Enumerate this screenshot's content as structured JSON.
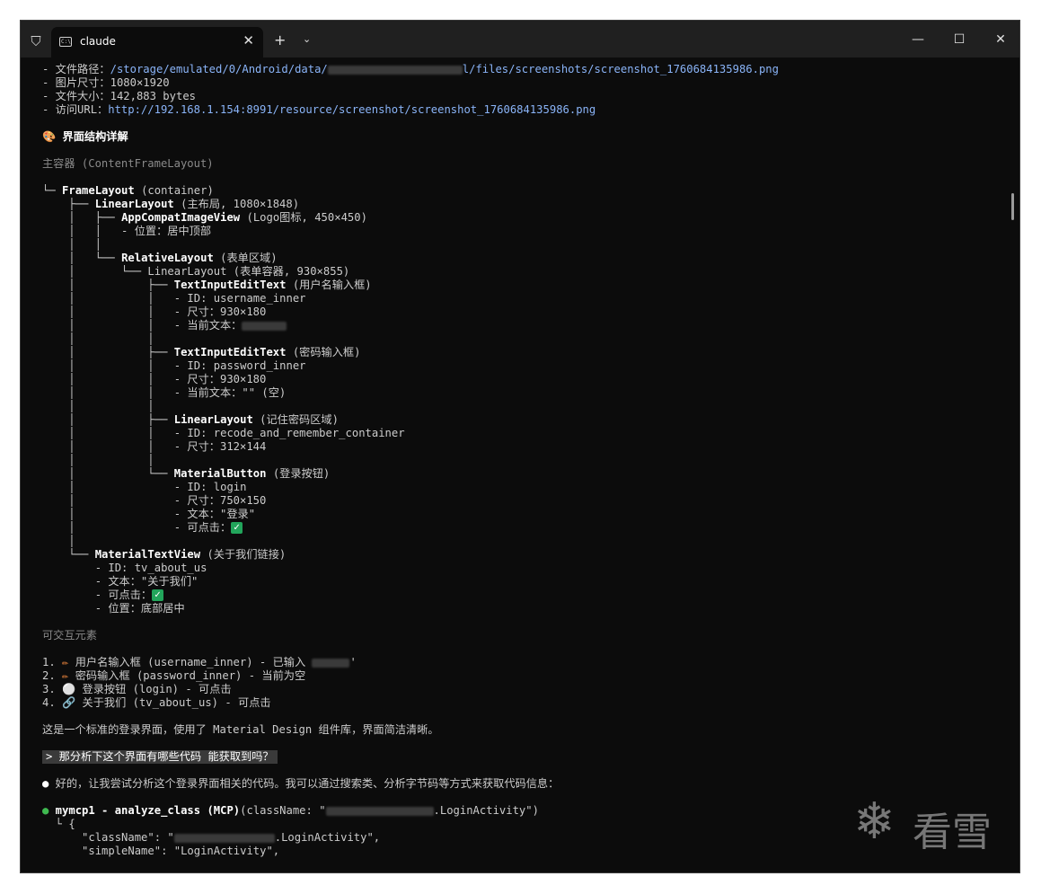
{
  "window": {
    "tab_title": "claude",
    "tab_close": "✕",
    "new_tab": "+",
    "dropdown": "⌄",
    "minimize": "—",
    "maximize": "☐",
    "close": "✕"
  },
  "lines": {
    "l1a": "- 文件路径：",
    "l1b": "/storage/emulated/0/Android/data/",
    "l1c": "l/files/screenshots/screenshot_1760684135986.png",
    "l2": "- 图片尺寸：1080×1920",
    "l3": "- 文件大小：142,883 bytes",
    "l4a": "- 访问URL：",
    "l4b": "http://192.168.1.154:8991/resource/screenshot/screenshot_1760684135986.png",
    "l5": "🎨 界面结构详解",
    "l6": "主容器 (ContentFrameLayout)",
    "t1a": "└─ ",
    "t1b": "FrameLayout",
    "t1c": " (container)",
    "t2a": "    ├── ",
    "t2b": "LinearLayout",
    "t2c": " (主布局, 1080×1848)",
    "t3a": "    │   ├── ",
    "t3b": "AppCompatImageView",
    "t3c": " (Logo图标, 450×450)",
    "t4": "    │   │   - 位置：居中顶部",
    "t5": "    │   │",
    "t6a": "    │   └── ",
    "t6b": "RelativeLayout",
    "t6c": " (表单区域)",
    "t7": "    │       └── LinearLayout (表单容器, 930×855)",
    "t8a": "    │           ├── ",
    "t8b": "TextInputEditText",
    "t8c": " (用户名输入框)",
    "t9": "    │           │   - ID: username_inner",
    "t10": "    │           │   - 尺寸：930×180",
    "t11": "    │           │   - 当前文本：",
    "t12": "    │           │",
    "t13a": "    │           ├── ",
    "t13b": "TextInputEditText",
    "t13c": " (密码输入框)",
    "t14": "    │           │   - ID: password_inner",
    "t15": "    │           │   - 尺寸：930×180",
    "t16": "    │           │   - 当前文本：\"\" (空)",
    "t17": "    │           │",
    "t18a": "    │           ├── ",
    "t18b": "LinearLayout",
    "t18c": " (记住密码区域)",
    "t19": "    │           │   - ID: recode_and_remember_container",
    "t20": "    │           │   - 尺寸：312×144",
    "t21": "    │           │",
    "t22a": "    │           └── ",
    "t22b": "MaterialButton",
    "t22c": " (登录按钮)",
    "t23": "    │               - ID: login",
    "t24": "    │               - 尺寸：750×150",
    "t25": "    │               - 文本：\"登录\"",
    "t26": "    │               - 可点击：",
    "t27": "    │",
    "t28a": "    └── ",
    "t28b": "MaterialTextView",
    "t28c": " (关于我们链接)",
    "t29": "        - ID: tv_about_us",
    "t30": "        - 文本：\"关于我们\"",
    "t31": "        - 可点击：",
    "t32": "        - 位置：底部居中",
    "s1": "可交互元素",
    "i1a": "1. ",
    "i1b": "✏",
    "i1c": " 用户名输入框 (username_inner) - 已输入 ",
    "i1d": "'",
    "i2a": "2. ",
    "i2b": "✏",
    "i2c": " 密码输入框 (password_inner) - 当前为空",
    "i3a": "3. ",
    "i3b": "⚪",
    "i3c": " 登录按钮 (login) - 可点击",
    "i4a": "4. ",
    "i4b": "🔗",
    "i4c": " 关于我们 (tv_about_us) - 可点击",
    "summary": "这是一个标准的登录界面，使用了 Material Design 组件库，界面简洁清晰。",
    "prompt": "> 那分析下这个界面有哪些代码 能获取到吗？",
    "answer_bullet": "●",
    "answer": " 好的，让我尝试分析这个登录界面相关的代码。我可以通过搜索类、分析字节码等方式来获取代码信息：",
    "tool_bullet": "●",
    "tool_name": " mymcp1 - analyze_class (MCP)",
    "tool_args_a": "(className: \"",
    "tool_args_b": ".LoginActivity\")",
    "j1": "  └ {",
    "j2a": "      \"className\": \"",
    "j2b": ".LoginActivity\",",
    "j3": "      \"simpleName\": \"LoginActivity\","
  },
  "check_glyph": "✓",
  "watermark": {
    "icon": "❄",
    "text": "看雪"
  }
}
